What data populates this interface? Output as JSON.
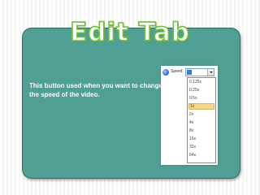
{
  "slide": {
    "title": "Edit Tab",
    "description": "This button used when you want to change the speed of the video."
  },
  "speed_control": {
    "label": "Speed:",
    "options": [
      "0.125x",
      "0.25x",
      "0.5x",
      "1x",
      "2x",
      "4x",
      "8x",
      "16x",
      "32x",
      "64x"
    ],
    "selected": "1x"
  },
  "colors": {
    "panel": "#4f9f95",
    "title_outline": "#6fbf3a",
    "selected_option": "#f7d58a"
  },
  "icons": {
    "speed": "speed-gear-icon",
    "dropdown": "chevron-down-icon"
  }
}
